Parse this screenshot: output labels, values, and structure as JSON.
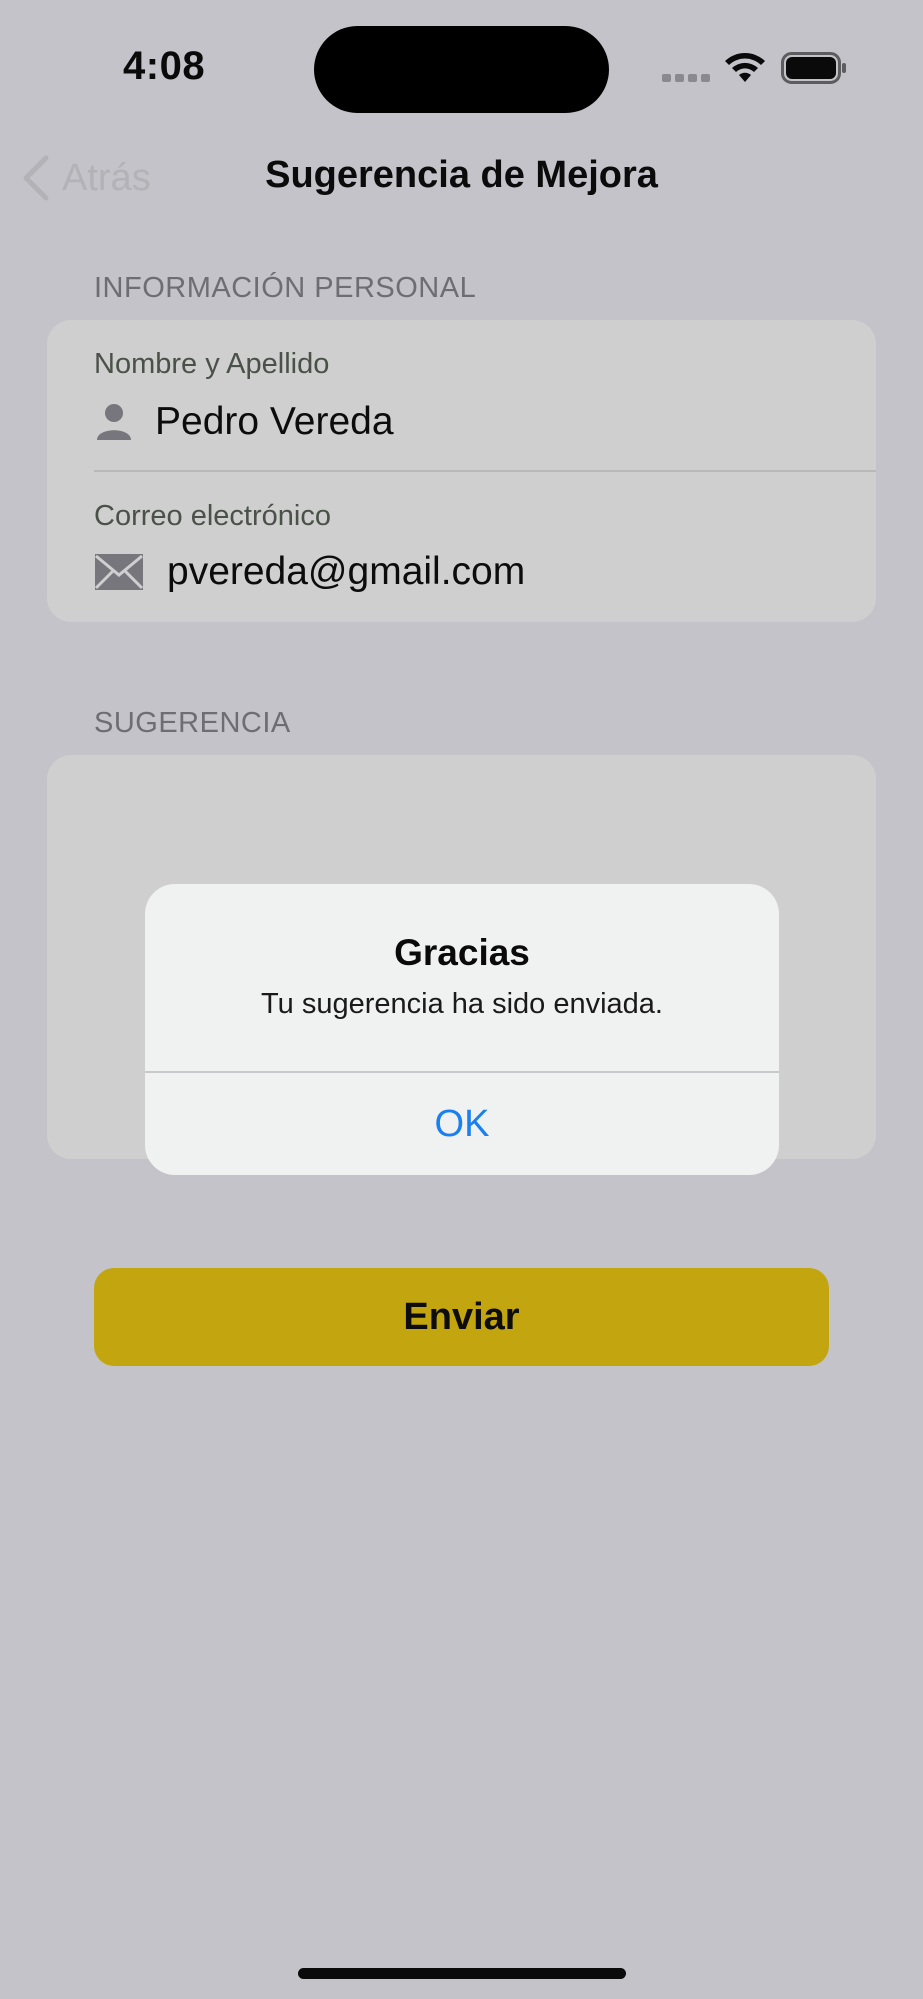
{
  "status_bar": {
    "time": "4:08"
  },
  "nav": {
    "back_label": "Atrás",
    "title": "Sugerencia de Mejora"
  },
  "personal_section": {
    "header": "INFORMACIÓN PERSONAL",
    "name_label": "Nombre y Apellido",
    "name_value": "Pedro Vereda",
    "email_label": "Correo electrónico",
    "email_value": "pvereda@gmail.com"
  },
  "suggestion_section": {
    "header": "SUGERENCIA",
    "text_value": ""
  },
  "send_button_label": "Enviar",
  "alert": {
    "title": "Gracias",
    "message": "Tu sugerencia ha sido enviada.",
    "ok_label": "OK"
  },
  "colors": {
    "background": "#c4c3c9",
    "accent_button": "#c3a60f",
    "alert_action": "#1a80f0"
  },
  "icons": [
    "person-icon",
    "envelope-icon",
    "chevron-left-icon",
    "wifi-icon",
    "battery-icon"
  ]
}
